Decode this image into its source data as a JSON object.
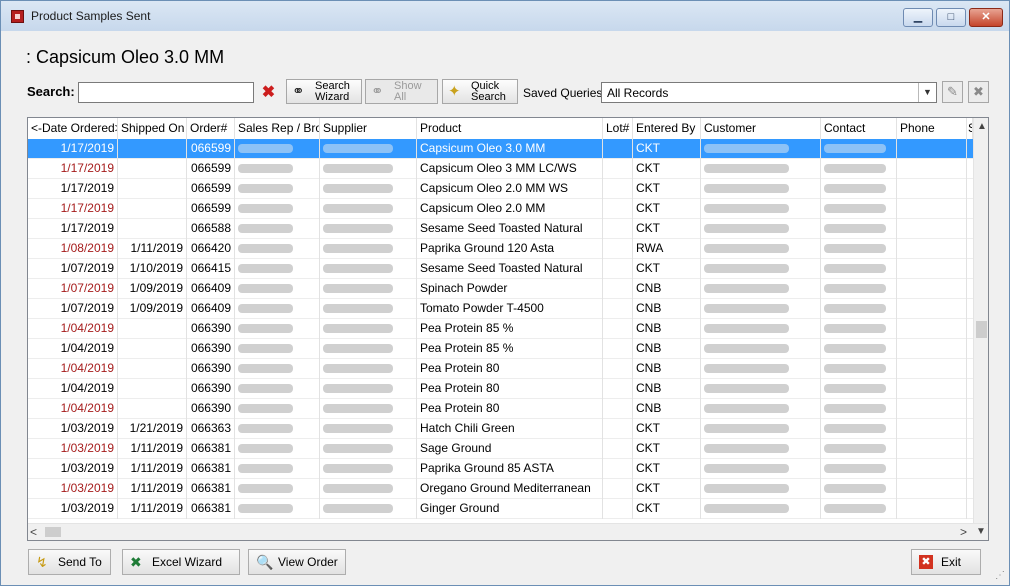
{
  "window": {
    "title": "Product Samples Sent",
    "min_glyph": "▁",
    "max_glyph": "□",
    "close_glyph": "✕"
  },
  "page_title": ": Capsicum Oleo 3.0 MM",
  "search": {
    "label": "Search:",
    "value": "",
    "clear_glyph": "✖"
  },
  "toolbar": {
    "search_wizard": "Search Wizard",
    "show_all": "Show All",
    "quick_search": "Quick Search",
    "binoculars_glyph": "⚭",
    "quick_glyph": "✦"
  },
  "saved_queries": {
    "label": "Saved Queries:",
    "value": "All Records",
    "arrow_glyph": "▼",
    "save_glyph": "✎",
    "delete_glyph": "✖"
  },
  "grid": {
    "columns": [
      "<-Date Ordered>",
      "Shipped On",
      "Order#",
      "Sales Rep / Brok",
      "Supplier",
      "Product",
      "Lot#",
      "Entered By",
      "Customer",
      "Contact",
      "Phone",
      "S"
    ],
    "rows": [
      {
        "date": "1/17/2019",
        "shipped": "",
        "order": "066599",
        "product": "Capsicum Oleo 3.0 MM",
        "lot": "",
        "entered": "CKT",
        "red": false,
        "selected": true
      },
      {
        "date": "1/17/2019",
        "shipped": "",
        "order": "066599",
        "product": "Capsicum Oleo 3 MM  LC/WS",
        "lot": "",
        "entered": "CKT",
        "red": true,
        "selected": false
      },
      {
        "date": "1/17/2019",
        "shipped": "",
        "order": "066599",
        "product": "Capsicum Oleo 2.0 MM WS",
        "lot": "",
        "entered": "CKT",
        "red": false,
        "selected": false
      },
      {
        "date": "1/17/2019",
        "shipped": "",
        "order": "066599",
        "product": "Capsicum Oleo 2.0 MM",
        "lot": "",
        "entered": "CKT",
        "red": true,
        "selected": false
      },
      {
        "date": "1/17/2019",
        "shipped": "",
        "order": "066588",
        "product": "Sesame Seed Toasted Natural",
        "lot": "",
        "entered": "CKT",
        "red": false,
        "selected": false
      },
      {
        "date": "1/08/2019",
        "shipped": "1/11/2019",
        "order": "066420",
        "product": "Paprika Ground 120 Asta",
        "lot": "",
        "entered": "RWA",
        "red": true,
        "selected": false
      },
      {
        "date": "1/07/2019",
        "shipped": "1/10/2019",
        "order": "066415",
        "product": "Sesame Seed Toasted Natural",
        "lot": "",
        "entered": "CKT",
        "red": false,
        "selected": false
      },
      {
        "date": "1/07/2019",
        "shipped": "1/09/2019",
        "order": "066409",
        "product": "Spinach   Powder",
        "lot": "",
        "entered": "CNB",
        "red": true,
        "selected": false
      },
      {
        "date": "1/07/2019",
        "shipped": "1/09/2019",
        "order": "066409",
        "product": "Tomato Powder T-4500",
        "lot": "",
        "entered": "CNB",
        "red": false,
        "selected": false
      },
      {
        "date": "1/04/2019",
        "shipped": "",
        "order": "066390",
        "product": "Pea Protein 85 %",
        "lot": "",
        "entered": "CNB",
        "red": true,
        "selected": false
      },
      {
        "date": "1/04/2019",
        "shipped": "",
        "order": "066390",
        "product": "Pea Protein 85 %",
        "lot": "",
        "entered": "CNB",
        "red": false,
        "selected": false
      },
      {
        "date": "1/04/2019",
        "shipped": "",
        "order": "066390",
        "product": "Pea Protein  80",
        "lot": "",
        "entered": "CNB",
        "red": true,
        "selected": false
      },
      {
        "date": "1/04/2019",
        "shipped": "",
        "order": "066390",
        "product": "Pea Protein  80",
        "lot": "",
        "entered": "CNB",
        "red": false,
        "selected": false
      },
      {
        "date": "1/04/2019",
        "shipped": "",
        "order": "066390",
        "product": "Pea Protein  80",
        "lot": "",
        "entered": "CNB",
        "red": true,
        "selected": false
      },
      {
        "date": "1/03/2019",
        "shipped": "1/21/2019",
        "order": "066363",
        "product": "Hatch Chili Green",
        "lot": "",
        "entered": "CKT",
        "red": false,
        "selected": false
      },
      {
        "date": "1/03/2019",
        "shipped": "1/11/2019",
        "order": "066381",
        "product": "Sage Ground",
        "lot": "",
        "entered": "CKT",
        "red": true,
        "selected": false
      },
      {
        "date": "1/03/2019",
        "shipped": "1/11/2019",
        "order": "066381",
        "product": "Paprika Ground 85 ASTA",
        "lot": "",
        "entered": "CKT",
        "red": false,
        "selected": false
      },
      {
        "date": "1/03/2019",
        "shipped": "1/11/2019",
        "order": "066381",
        "product": "Oregano Ground Mediterranean",
        "lot": "",
        "entered": "CKT",
        "red": true,
        "selected": false
      },
      {
        "date": "1/03/2019",
        "shipped": "1/11/2019",
        "order": "066381",
        "product": "Ginger Ground",
        "lot": "",
        "entered": "CKT",
        "red": false,
        "selected": false
      }
    ],
    "scroll_up_glyph": "▲",
    "scroll_down_glyph": "▼",
    "scroll_left_glyph": "<",
    "scroll_right_glyph": ">"
  },
  "footer": {
    "send_to": "Send To",
    "excel_wizard": "Excel Wizard",
    "view_order": "View Order",
    "exit": "Exit",
    "send_glyph": "↯",
    "excel_glyph": "✖",
    "view_glyph": "🔍",
    "exit_glyph": "✖",
    "grip_glyph": "⋰"
  },
  "colors": {
    "selection": "#3399ff",
    "red_date": "#a51b1b",
    "close_button": "#c5452b"
  }
}
